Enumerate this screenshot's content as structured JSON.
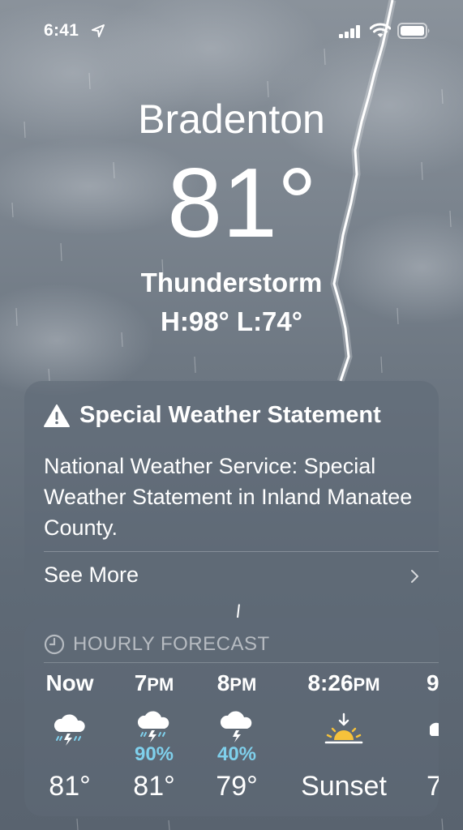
{
  "status": {
    "time": "6:41"
  },
  "weather": {
    "city": "Bradenton",
    "temperature": "81°",
    "condition": "Thunderstorm",
    "high_low": "H:98°  L:74°"
  },
  "alert": {
    "title": "Special Weather Statement",
    "body": "National Weather Service: Special Weather Statement in Inland Manatee County.",
    "see_more": "See More"
  },
  "hourly": {
    "header": "HOURLY FORECAST",
    "items": [
      {
        "hour": "Now",
        "ampm": "",
        "icon": "thunderstorm-icon",
        "precip": "",
        "temp": "81°"
      },
      {
        "hour": "7",
        "ampm": "PM",
        "icon": "thunderstorm-icon",
        "precip": "90%",
        "temp": "81°"
      },
      {
        "hour": "8",
        "ampm": "PM",
        "icon": "lightning-cloud-icon",
        "precip": "40%",
        "temp": "79°"
      },
      {
        "hour": "8:26",
        "ampm": "PM",
        "icon": "sunset-icon",
        "precip": "",
        "temp": "Sunset"
      },
      {
        "hour": "9",
        "ampm": "",
        "icon": "cloud-icon",
        "precip": "",
        "temp": "7"
      }
    ]
  },
  "colors": {
    "precip": "#7fd0ec",
    "sun": "#f6c23b"
  }
}
